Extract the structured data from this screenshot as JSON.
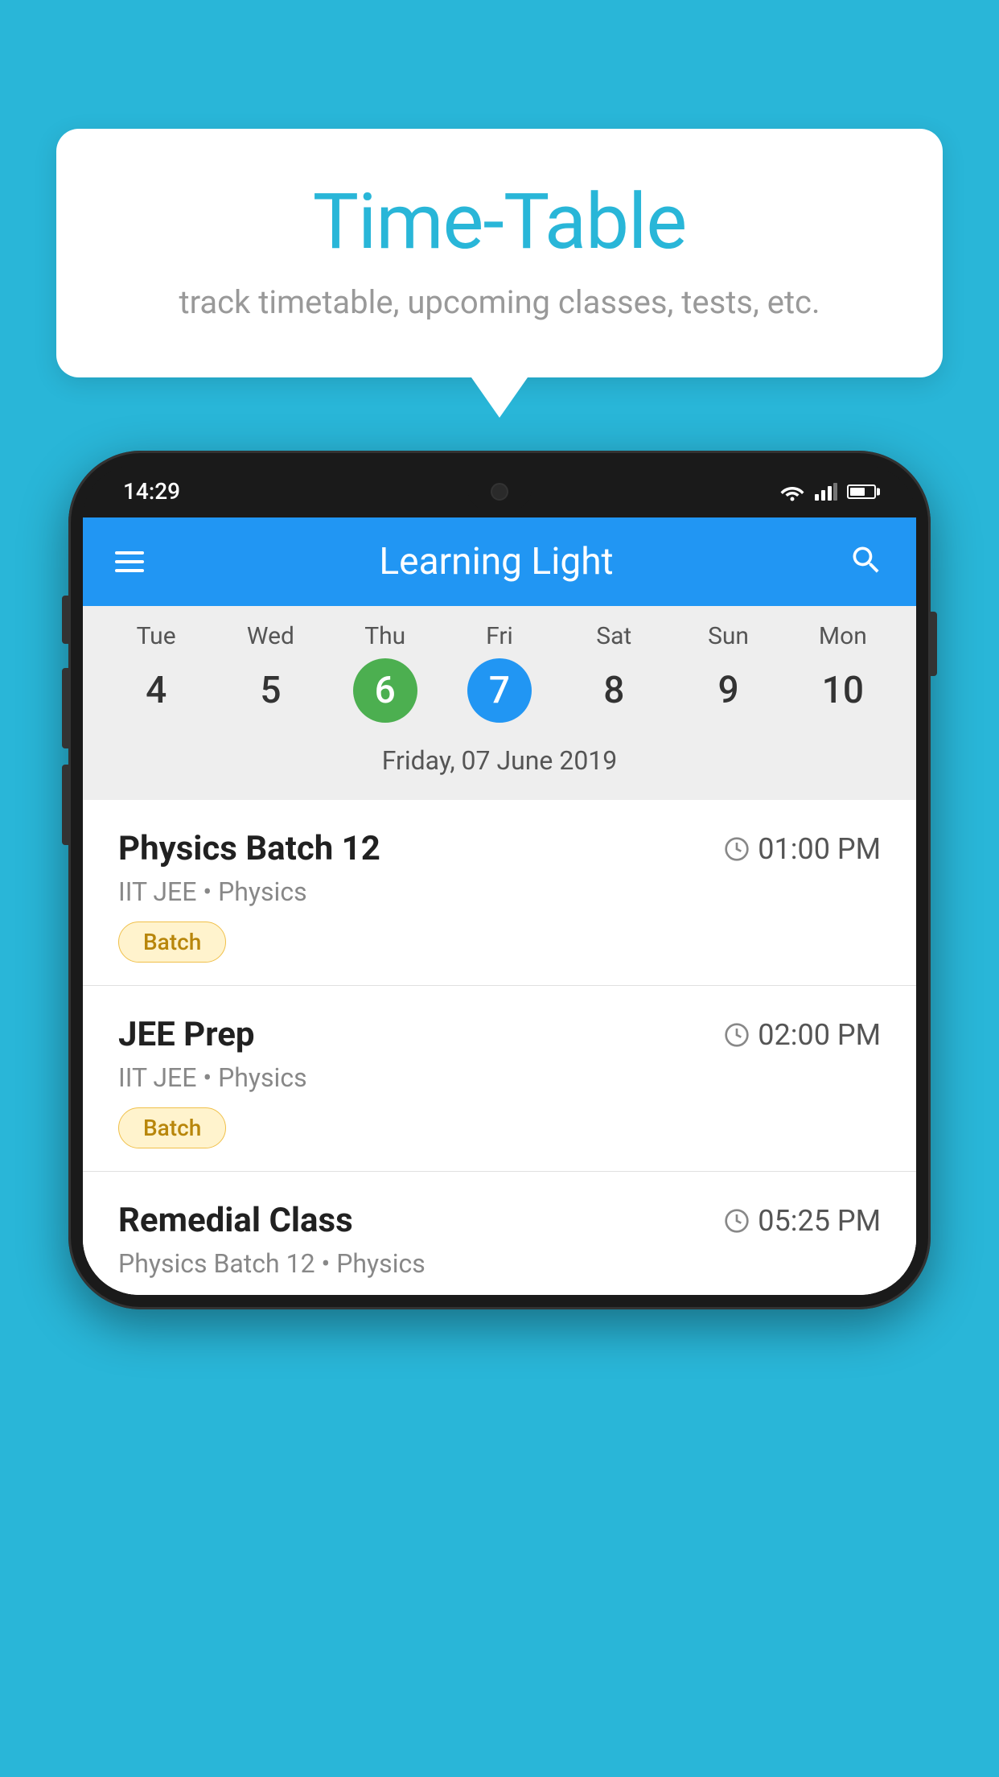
{
  "background_color": "#29B6D8",
  "speech_bubble": {
    "title": "Time-Table",
    "subtitle": "track timetable, upcoming classes, tests, etc."
  },
  "phone": {
    "status_bar": {
      "time": "14:29"
    },
    "app_bar": {
      "title": "Learning Light"
    },
    "calendar": {
      "days": [
        {
          "name": "Tue",
          "num": "4",
          "state": "normal"
        },
        {
          "name": "Wed",
          "num": "5",
          "state": "normal"
        },
        {
          "name": "Thu",
          "num": "6",
          "state": "today"
        },
        {
          "name": "Fri",
          "num": "7",
          "state": "selected"
        },
        {
          "name": "Sat",
          "num": "8",
          "state": "normal"
        },
        {
          "name": "Sun",
          "num": "9",
          "state": "normal"
        },
        {
          "name": "Mon",
          "num": "10",
          "state": "normal"
        }
      ],
      "selected_date_label": "Friday, 07 June 2019"
    },
    "schedule": [
      {
        "title": "Physics Batch 12",
        "time": "01:00 PM",
        "meta": "IIT JEE • Physics",
        "badge": "Batch"
      },
      {
        "title": "JEE Prep",
        "time": "02:00 PM",
        "meta": "IIT JEE • Physics",
        "badge": "Batch"
      },
      {
        "title": "Remedial Class",
        "time": "05:25 PM",
        "meta": "Physics Batch 12 • Physics",
        "badge": null
      }
    ]
  }
}
